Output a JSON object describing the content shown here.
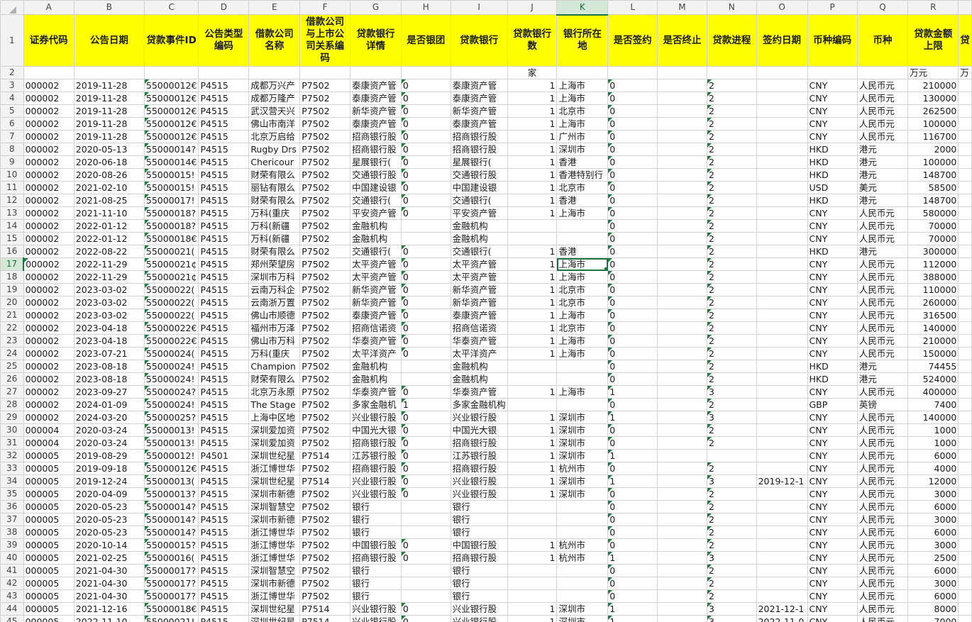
{
  "columns": [
    "A",
    "B",
    "C",
    "D",
    "E",
    "F",
    "G",
    "H",
    "I",
    "J",
    "K",
    "L",
    "M",
    "N",
    "O",
    "P",
    "Q",
    "R",
    ""
  ],
  "active_column": "K",
  "active_row": "17",
  "header_row": {
    "row_num": "1",
    "cells": [
      "证券代码",
      "公告日期",
      "贷款事件ID",
      "公告类型编码",
      "借款公司名称",
      "借款公司与上市公司关系编码",
      "贷款银行详情",
      "是否银团",
      "贷款银行",
      "贷款银行数",
      "银行所在地",
      "是否签约",
      "是否终止",
      "贷款进程",
      "签约日期",
      "币种编码",
      "币种",
      "贷款金额上限",
      "贷"
    ]
  },
  "unit_row": {
    "row_num": "2",
    "cells": [
      "",
      "",
      "",
      "",
      "",
      "",
      "",
      "",
      "",
      "家",
      "",
      "",
      "",
      "",
      "",
      "",
      "",
      "万元",
      "万"
    ]
  },
  "rows": [
    {
      "n": "3",
      "c": [
        "000002",
        "2019-11-28",
        "55000012€",
        "P4515",
        "成都万兴产",
        "P7502",
        "泰康资产管",
        "0",
        "泰康资产管",
        "1",
        "上海市",
        "0",
        "",
        "2",
        "",
        "CNY",
        "人民币元",
        "210000",
        ""
      ]
    },
    {
      "n": "4",
      "c": [
        "000002",
        "2019-11-28",
        "55000012€",
        "P4515",
        "成都万隆产",
        "P7502",
        "泰康资产管",
        "0",
        "泰康资产管",
        "1",
        "上海市",
        "0",
        "",
        "2",
        "",
        "CNY",
        "人民币元",
        "130000",
        ""
      ]
    },
    {
      "n": "5",
      "c": [
        "000002",
        "2019-11-28",
        "55000012€",
        "P4515",
        "武汉营天兴",
        "P7502",
        "新华资产管",
        "0",
        "新华资产管",
        "1",
        "北京市",
        "0",
        "",
        "2",
        "",
        "CNY",
        "人民币元",
        "262500",
        ""
      ]
    },
    {
      "n": "6",
      "c": [
        "000002",
        "2019-11-28",
        "55000012€",
        "P4515",
        "佛山市南洋",
        "P7502",
        "泰康资产管",
        "0",
        "泰康资产管",
        "1",
        "上海市",
        "0",
        "",
        "2",
        "",
        "CNY",
        "人民币元",
        "100000",
        ""
      ]
    },
    {
      "n": "7",
      "c": [
        "000002",
        "2019-11-28",
        "55000012€",
        "P4515",
        "北京万启给",
        "P7502",
        "招商银行股",
        "0",
        "招商银行股",
        "1",
        "广州市",
        "0",
        "",
        "2",
        "",
        "CNY",
        "人民币元",
        "116700",
        ""
      ]
    },
    {
      "n": "8",
      "c": [
        "000002",
        "2020-05-13",
        "55000014?",
        "P4515",
        "Rugby Drs",
        "P7502",
        "招商银行股",
        "0",
        "招商银行股",
        "1",
        "深圳市",
        "0",
        "",
        "2",
        "",
        "HKD",
        "港元",
        "2000",
        ""
      ]
    },
    {
      "n": "9",
      "c": [
        "000002",
        "2020-06-18",
        "55000014€",
        "P4515",
        "Chericour",
        "P7502",
        "星展银行(",
        "0",
        "星展银行(",
        "1",
        "香港",
        "0",
        "",
        "2",
        "",
        "HKD",
        "港元",
        "100000",
        ""
      ]
    },
    {
      "n": "10",
      "c": [
        "000002",
        "2020-08-26",
        "55000015!",
        "P4515",
        "财荣有限么",
        "P7502",
        "交通银行股",
        "0",
        "交通银行股",
        "1",
        "香港特别行",
        "0",
        "",
        "2",
        "",
        "HKD",
        "港元",
        "148700",
        ""
      ]
    },
    {
      "n": "11",
      "c": [
        "000002",
        "2021-02-10",
        "55000015!",
        "P4515",
        "丽钻有限么",
        "P7502",
        "中国建设银",
        "0",
        "中国建设银",
        "1",
        "北京市",
        "0",
        "",
        "2",
        "",
        "USD",
        "美元",
        "58500",
        ""
      ]
    },
    {
      "n": "12",
      "c": [
        "000002",
        "2021-08-25",
        "55000017!",
        "P4515",
        "财荣有限么",
        "P7502",
        "交通银行(",
        "0",
        "交通银行(",
        "1",
        "香港",
        "0",
        "",
        "2",
        "",
        "HKD",
        "港元",
        "148700",
        ""
      ]
    },
    {
      "n": "13",
      "c": [
        "000002",
        "2021-11-10",
        "55000018?",
        "P4515",
        "万科(重庆",
        "P7502",
        "平安资产管",
        "0",
        "平安资产管",
        "1",
        "上海市",
        "0",
        "",
        "2",
        "",
        "CNY",
        "人民币元",
        "580000",
        ""
      ]
    },
    {
      "n": "14",
      "c": [
        "000002",
        "2022-01-12",
        "55000018?",
        "P4515",
        "万科(新疆",
        "P7502",
        "金融机构",
        "",
        "金融机构",
        "",
        "",
        "0",
        "",
        "2",
        "",
        "CNY",
        "人民币元",
        "70000",
        ""
      ]
    },
    {
      "n": "15",
      "c": [
        "000002",
        "2022-01-12",
        "55000018€",
        "P4515",
        "万科(新疆",
        "P7502",
        "金融机构",
        "",
        "金融机构",
        "",
        "",
        "0",
        "",
        "2",
        "",
        "CNY",
        "人民币元",
        "70000",
        ""
      ]
    },
    {
      "n": "16",
      "c": [
        "000002",
        "2022-08-22",
        "55000021(",
        "P4515",
        "财荣有限么",
        "P7502",
        "交通银行(",
        "0",
        "交通银行(",
        "1",
        "香港",
        "0",
        "",
        "2",
        "",
        "HKD",
        "港元",
        "300000",
        ""
      ]
    },
    {
      "n": "17",
      "c": [
        "000002",
        "2022-11-29",
        "55000021¢",
        "P4515",
        "郑州荣望房",
        "P7502",
        "太平资产管",
        "0",
        "太平资产管",
        "1",
        "上海市",
        "0",
        "",
        "2",
        "",
        "CNY",
        "人民币元",
        "112000",
        ""
      ]
    },
    {
      "n": "18",
      "c": [
        "000002",
        "2022-11-29",
        "55000021¢",
        "P4515",
        "深圳市万科",
        "P7502",
        "太平资产管",
        "0",
        "太平资产管",
        "1",
        "上海市",
        "0",
        "",
        "2",
        "",
        "CNY",
        "人民币元",
        "388000",
        ""
      ]
    },
    {
      "n": "19",
      "c": [
        "000002",
        "2023-03-02",
        "55000022(",
        "P4515",
        "云南万科企",
        "P7502",
        "新华资产管",
        "0",
        "新华资产管",
        "1",
        "北京市",
        "0",
        "",
        "2",
        "",
        "CNY",
        "人民币元",
        "110000",
        ""
      ]
    },
    {
      "n": "20",
      "c": [
        "000002",
        "2023-03-02",
        "55000022(",
        "P4515",
        "云南浙万置",
        "P7502",
        "新华资产管",
        "0",
        "新华资产管",
        "1",
        "北京市",
        "0",
        "",
        "2",
        "",
        "CNY",
        "人民币元",
        "260000",
        ""
      ]
    },
    {
      "n": "21",
      "c": [
        "000002",
        "2023-03-02",
        "55000022(",
        "P4515",
        "佛山市顺德",
        "P7502",
        "泰康资产管",
        "0",
        "泰康资产管",
        "1",
        "上海市",
        "0",
        "",
        "2",
        "",
        "CNY",
        "人民币元",
        "316500",
        ""
      ]
    },
    {
      "n": "22",
      "c": [
        "000002",
        "2023-04-18",
        "55000022€",
        "P4515",
        "福州市万泽",
        "P7502",
        "招商信诺资",
        "0",
        "招商信诺资",
        "1",
        "北京市",
        "0",
        "",
        "2",
        "",
        "CNY",
        "人民币元",
        "140000",
        ""
      ]
    },
    {
      "n": "23",
      "c": [
        "000002",
        "2023-04-18",
        "55000022€",
        "P4515",
        "佛山市万科",
        "P7502",
        "华泰资产管",
        "0",
        "华泰资产管",
        "1",
        "上海市",
        "0",
        "",
        "2",
        "",
        "CNY",
        "人民币元",
        "210000",
        ""
      ]
    },
    {
      "n": "24",
      "c": [
        "000002",
        "2023-07-21",
        "55000024(",
        "P4515",
        "万科(重庆",
        "P7502",
        "太平洋资产",
        "0",
        "太平洋资产",
        "1",
        "上海市",
        "0",
        "",
        "2",
        "",
        "CNY",
        "人民币元",
        "150000",
        ""
      ]
    },
    {
      "n": "25",
      "c": [
        "000002",
        "2023-08-18",
        "55000024!",
        "P4515",
        "Champion",
        "P7502",
        "金融机构",
        "",
        "金融机构",
        "",
        "",
        "0",
        "",
        "2",
        "",
        "HKD",
        "港元",
        "74455",
        ""
      ]
    },
    {
      "n": "26",
      "c": [
        "000002",
        "2023-08-18",
        "55000024!",
        "P4515",
        "财荣有限么",
        "P7502",
        "金融机构",
        "",
        "金融机构",
        "",
        "",
        "0",
        "",
        "2",
        "",
        "HKD",
        "港元",
        "524000",
        ""
      ]
    },
    {
      "n": "27",
      "c": [
        "000002",
        "2023-09-27",
        "55000024?",
        "P4515",
        "北京万永原",
        "P7502",
        "华泰资产管",
        "0",
        "华泰资产管",
        "1",
        "上海市",
        "1",
        "",
        "3",
        "",
        "CNY",
        "人民币元",
        "400000",
        ""
      ]
    },
    {
      "n": "28",
      "c": [
        "000002",
        "2024-01-09",
        "55000024!",
        "P4515",
        "The Stage",
        "P7502",
        "多家金融机",
        "1",
        "多家金融机构",
        "",
        "",
        "0",
        "",
        "2",
        "",
        "GBP",
        "英镑",
        "7400",
        ""
      ]
    },
    {
      "n": "29",
      "c": [
        "000002",
        "2024-03-20",
        "55000025?",
        "P4515",
        "上海中区地",
        "P7502",
        "兴业银行股",
        "0",
        "兴业银行股",
        "1",
        "深圳市",
        "1",
        "",
        "3",
        "",
        "CNY",
        "人民币元",
        "140000",
        ""
      ]
    },
    {
      "n": "30",
      "c": [
        "000004",
        "2020-03-24",
        "55000013!",
        "P4515",
        "深圳爱加资",
        "P7502",
        "中国光大银",
        "0",
        "中国光大银",
        "1",
        "深圳市",
        "0",
        "",
        "2",
        "",
        "CNY",
        "人民币元",
        "1000",
        ""
      ]
    },
    {
      "n": "31",
      "c": [
        "000004",
        "2020-03-24",
        "55000013!",
        "P4515",
        "深圳爱加资",
        "P7502",
        "招商银行股",
        "0",
        "招商银行股",
        "1",
        "深圳市",
        "0",
        "",
        "2",
        "",
        "CNY",
        "人民币元",
        "1000",
        ""
      ]
    },
    {
      "n": "32",
      "c": [
        "000005",
        "2019-08-29",
        "55000012!",
        "P4501",
        "深圳世纪星",
        "P7514",
        "江苏银行股",
        "0",
        "江苏银行股",
        "1",
        "深圳市",
        "1",
        "",
        "",
        "",
        "CNY",
        "人民币元",
        "6000",
        ""
      ]
    },
    {
      "n": "33",
      "c": [
        "000005",
        "2019-09-18",
        "55000012€",
        "P4515",
        "浙江博世华",
        "P7502",
        "招商银行股",
        "0",
        "招商银行股",
        "1",
        "杭州市",
        "0",
        "",
        "2",
        "",
        "CNY",
        "人民币元",
        "4000",
        ""
      ]
    },
    {
      "n": "34",
      "c": [
        "000005",
        "2019-12-24",
        "55000013(",
        "P4515",
        "深圳世纪星",
        "P7514",
        "兴业银行股",
        "0",
        "兴业银行股",
        "1",
        "深圳市",
        "1",
        "",
        "3",
        "2019-12-1",
        "CNY",
        "人民币元",
        "12000",
        ""
      ]
    },
    {
      "n": "35",
      "c": [
        "000005",
        "2020-04-09",
        "55000013?",
        "P4515",
        "深圳市新德",
        "P7502",
        "兴业银行股",
        "0",
        "兴业银行股",
        "1",
        "深圳市",
        "0",
        "",
        "2",
        "",
        "CNY",
        "人民币元",
        "3000",
        ""
      ]
    },
    {
      "n": "36",
      "c": [
        "000005",
        "2020-05-23",
        "55000014?",
        "P4515",
        "深圳智慧空",
        "P7502",
        "银行",
        "",
        "银行",
        "",
        "",
        "0",
        "",
        "2",
        "",
        "CNY",
        "人民币元",
        "6000",
        ""
      ]
    },
    {
      "n": "37",
      "c": [
        "000005",
        "2020-05-23",
        "55000014?",
        "P4515",
        "深圳市新德",
        "P7502",
        "银行",
        "",
        "银行",
        "",
        "",
        "0",
        "",
        "2",
        "",
        "CNY",
        "人民币元",
        "3000",
        ""
      ]
    },
    {
      "n": "38",
      "c": [
        "000005",
        "2020-05-23",
        "55000014?",
        "P4515",
        "浙江博世华",
        "P7502",
        "银行",
        "",
        "银行",
        "",
        "",
        "0",
        "",
        "2",
        "",
        "CNY",
        "人民币元",
        "6000",
        ""
      ]
    },
    {
      "n": "39",
      "c": [
        "000005",
        "2020-10-14",
        "55000015?",
        "P4515",
        "浙江博世华",
        "P7502",
        "中国银行股",
        "0",
        "中国银行股",
        "1",
        "杭州市",
        "0",
        "",
        "2",
        "",
        "CNY",
        "人民币元",
        "3000",
        ""
      ]
    },
    {
      "n": "40",
      "c": [
        "000005",
        "2021-02-25",
        "55000016(",
        "P4515",
        "浙江博世华",
        "P7502",
        "招商银行股",
        "0",
        "招商银行股",
        "1",
        "杭州市",
        "1",
        "",
        "3",
        "",
        "CNY",
        "人民币元",
        "2500",
        ""
      ]
    },
    {
      "n": "41",
      "c": [
        "000005",
        "2021-04-30",
        "55000017?",
        "P4515",
        "深圳智慧空",
        "P7502",
        "银行",
        "",
        "银行",
        "",
        "",
        "0",
        "",
        "2",
        "",
        "CNY",
        "人民币元",
        "6000",
        ""
      ]
    },
    {
      "n": "42",
      "c": [
        "000005",
        "2021-04-30",
        "55000017?",
        "P4515",
        "深圳市新德",
        "P7502",
        "银行",
        "",
        "银行",
        "",
        "",
        "0",
        "",
        "2",
        "",
        "CNY",
        "人民币元",
        "3000",
        ""
      ]
    },
    {
      "n": "43",
      "c": [
        "000005",
        "2021-04-30",
        "55000017?",
        "P4515",
        "浙江博世华",
        "P7502",
        "银行",
        "",
        "银行",
        "",
        "",
        "0",
        "",
        "2",
        "",
        "CNY",
        "人民币元",
        "6000",
        ""
      ]
    },
    {
      "n": "44",
      "c": [
        "000005",
        "2021-12-16",
        "55000018€",
        "P4515",
        "深圳世纪星",
        "P7514",
        "兴业银行股",
        "0",
        "兴业银行股",
        "1",
        "深圳市",
        "1",
        "",
        "3",
        "2021-12-1",
        "CNY",
        "人民币元",
        "8000",
        ""
      ]
    },
    {
      "n": "45",
      "c": [
        "000005",
        "2022-11-10",
        "55000021!",
        "P4515",
        "深圳世纪星",
        "P7514",
        "兴业银行股",
        "0",
        "兴业银行股",
        "1",
        "深圳市",
        "1",
        "",
        "3",
        "2022-11-0",
        "CNY",
        "人民币元",
        "7000",
        ""
      ]
    }
  ]
}
